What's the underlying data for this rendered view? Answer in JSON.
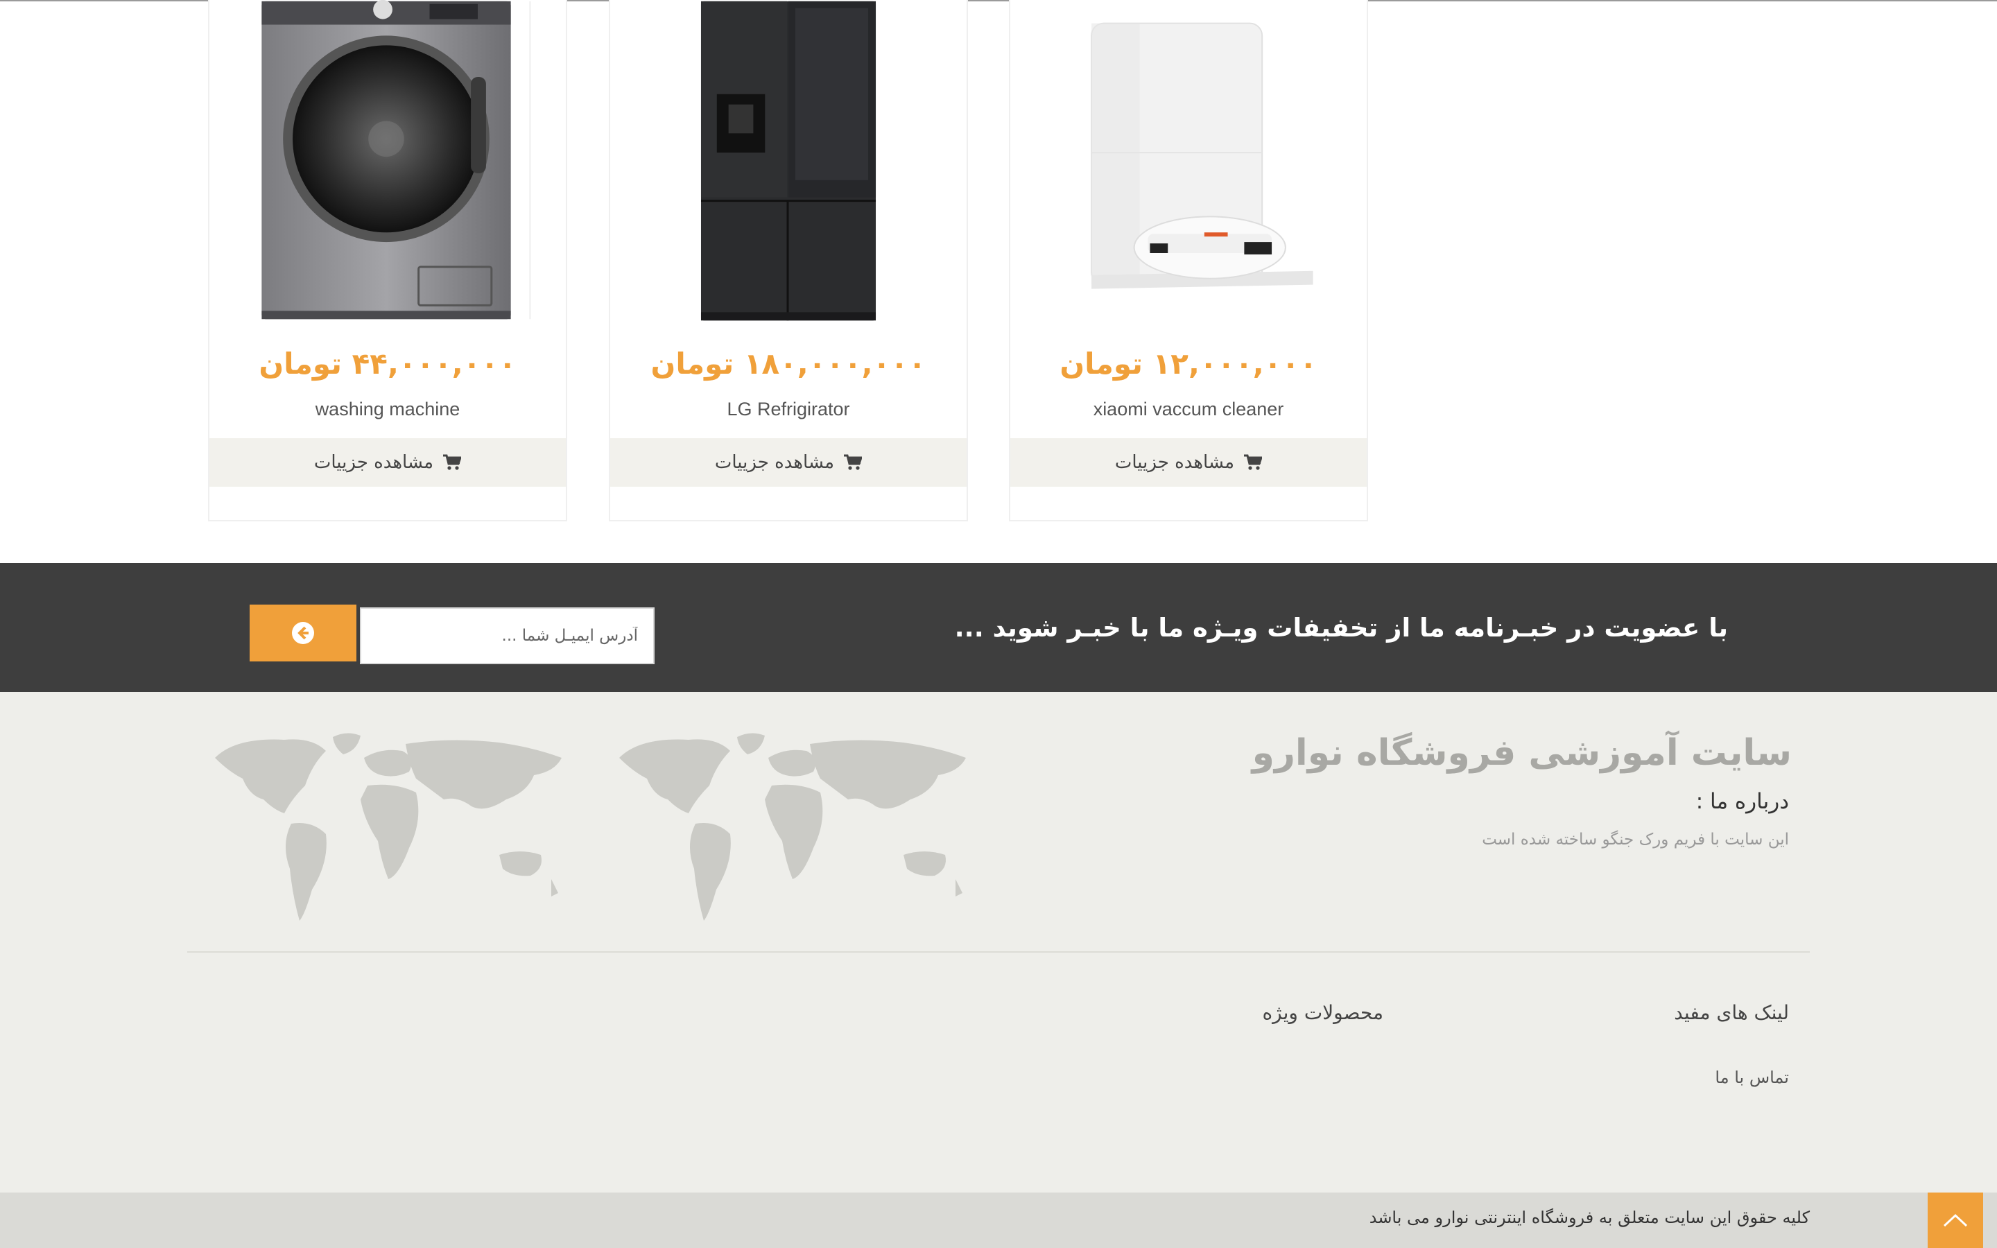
{
  "products": [
    {
      "price": "۴۴,۰۰۰,۰۰۰ تومان",
      "name": "washing machine",
      "details_label": "مشاهده جزییات",
      "image": "washing-machine"
    },
    {
      "price": "۱۸۰,۰۰۰,۰۰۰ تومان",
      "name": "LG Refrigirator",
      "details_label": "مشاهده جزییات",
      "image": "refrigerator"
    },
    {
      "price": "۱۲,۰۰۰,۰۰۰ تومان",
      "name": "xiaomi vaccum cleaner",
      "details_label": "مشاهده جزییات",
      "image": "robot-vacuum"
    }
  ],
  "newsletter": {
    "title": "با عضویت در خبـرنامه ما از تخفیفات ویـژه ما با خبـر شوید ...",
    "email_placeholder": "آدرس ایمیـل شما ...",
    "submit_icon": "arrow-circle-left-icon"
  },
  "footer": {
    "site_title": "سایت آموزشی فروشگاه نوارو",
    "about_heading": "درباره ما :",
    "about_text": "این سایت با فریم ورک جنگو ساخته شده است",
    "useful_links_heading": "لینک های مفید",
    "special_products_heading": "محصولات ویژه",
    "links": [
      "تماس با ما"
    ],
    "copyright": "کلیه حقوق این سایت متعلق به فروشگاه اینترنتی نوارو می باشد",
    "to_top_icon": "chevron-up-icon"
  },
  "colors": {
    "accent": "#f0a03a",
    "dark_band": "#3e3e3e",
    "footer_bg": "#eeeeea",
    "bottom_bar": "#dadad6"
  }
}
